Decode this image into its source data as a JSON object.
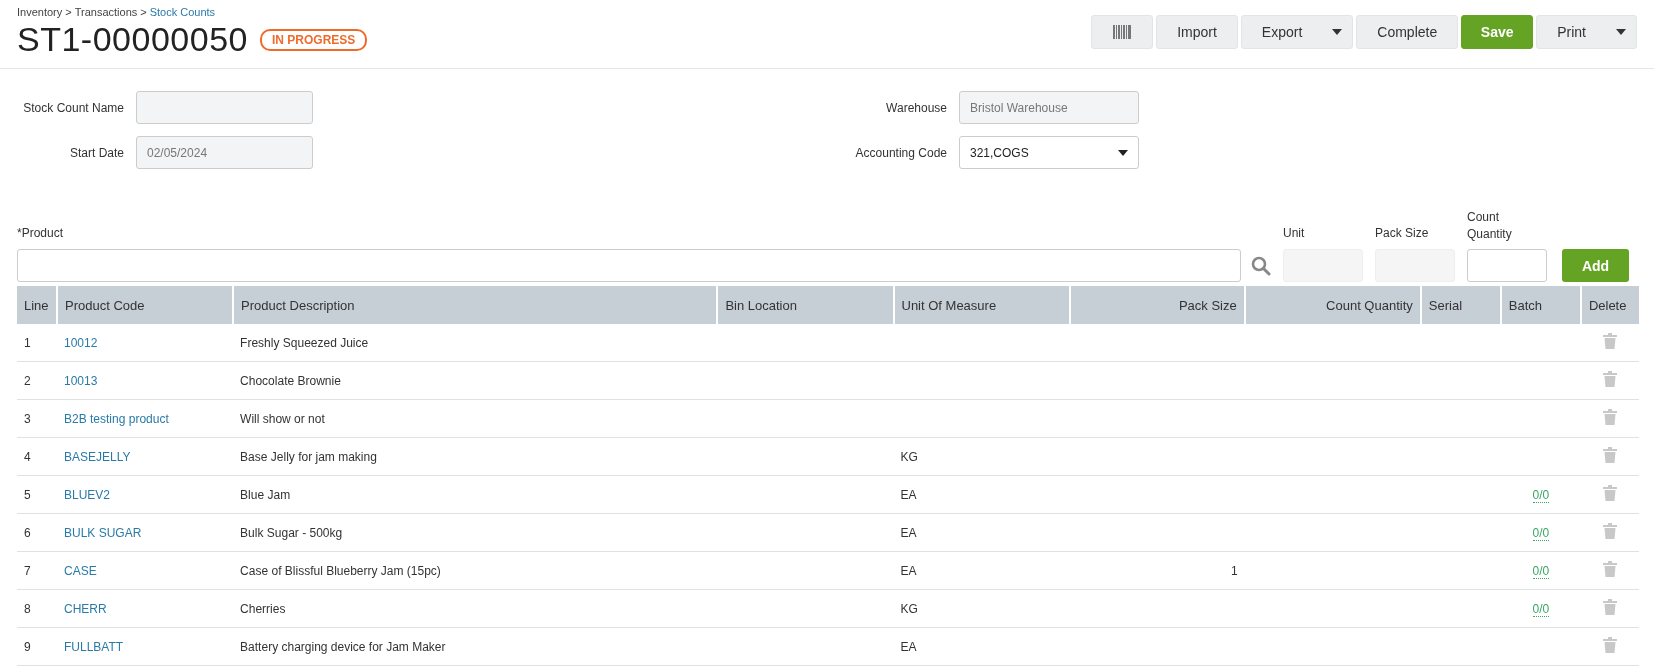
{
  "breadcrumb": [
    {
      "label": "Inventory",
      "current": false
    },
    {
      "label": "Transactions",
      "current": false
    },
    {
      "label": "Stock Counts",
      "current": true
    }
  ],
  "breadcrumb_separator": ">",
  "title": "ST1-00000050",
  "status": "IN PROGRESS",
  "toolbar": [
    {
      "kind": "barcode"
    },
    {
      "kind": "plain",
      "label": "Import"
    },
    {
      "kind": "dropdown",
      "label": "Export"
    },
    {
      "kind": "plain",
      "label": "Complete"
    },
    {
      "kind": "primary",
      "label": "Save"
    },
    {
      "kind": "dropdown",
      "label": "Print"
    }
  ],
  "form_left": [
    {
      "label": "Stock Count Name",
      "kind": "readonly"
    },
    {
      "label": "Start Date",
      "kind": "readonly",
      "value": "02/05/2024"
    }
  ],
  "form_right": [
    {
      "label": "Warehouse",
      "kind": "readonly",
      "value": "Bristol Warehouse"
    },
    {
      "label": "Accounting Code",
      "kind": "select",
      "value": "321,COGS"
    }
  ],
  "entry": {
    "product_label": "*Product",
    "unit_label": "Unit",
    "pack_size_label": "Pack Size",
    "count_label": "Count Quantity",
    "add": "Add"
  },
  "table": {
    "columns": [
      "Line",
      "Product Code",
      "Product Description",
      "Bin Location",
      "Unit Of Measure",
      "Pack Size",
      "Count Quantity",
      "Serial",
      "Batch",
      "Delete"
    ],
    "rows": [
      {
        "line": "1",
        "code": "10012",
        "description": "Freshly Squeezed Juice"
      },
      {
        "line": "2",
        "code": "10013",
        "description": "Chocolate Brownie"
      },
      {
        "line": "3",
        "code": "B2B testing product",
        "description": "Will show or not"
      },
      {
        "line": "4",
        "code": "BASEJELLY",
        "description": "Base Jelly for jam making",
        "uom": "KG"
      },
      {
        "line": "5",
        "code": "BLUEV2",
        "description": "Blue Jam",
        "uom": "EA",
        "batch": "0/0"
      },
      {
        "line": "6",
        "code": "BULK SUGAR",
        "description": "Bulk Sugar - 500kg",
        "uom": "EA",
        "batch": "0/0"
      },
      {
        "line": "7",
        "code": "CASE",
        "description": "Case of Blissful Blueberry Jam (15pc)",
        "uom": "EA",
        "pack_size": "1",
        "batch": "0/0"
      },
      {
        "line": "8",
        "code": "CHERR",
        "description": "Cherries",
        "uom": "KG",
        "batch": "0/0"
      },
      {
        "line": "9",
        "code": "FULLBATT",
        "description": "Battery charging device for Jam Maker",
        "uom": "EA"
      }
    ]
  }
}
